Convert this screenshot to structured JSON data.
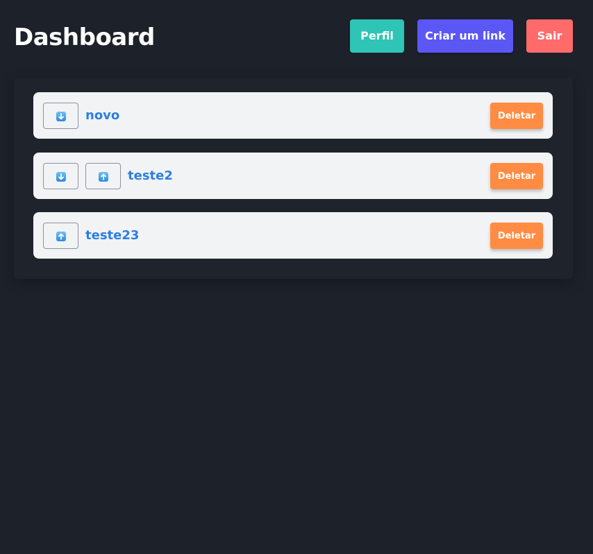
{
  "header": {
    "title": "Dashboard",
    "perfil_label": "Perfil",
    "criar_label": "Criar um link",
    "sair_label": "Sair"
  },
  "links": [
    {
      "name": "novo",
      "buttons": [
        "down-arrow-icon"
      ],
      "delete_label": "Deletar"
    },
    {
      "name": "teste2",
      "buttons": [
        "down-arrow-icon",
        "up-arrow-icon"
      ],
      "delete_label": "Deletar"
    },
    {
      "name": "teste23",
      "buttons": [
        "up-arrow-icon"
      ],
      "delete_label": "Deletar"
    }
  ],
  "colors": {
    "background": "#1d2129",
    "perfil": "#2ec4b6",
    "criar": "#5b57f5",
    "sair": "#ff6b6b",
    "deletar": "#ff8c42",
    "link_text": "#2b7fe0",
    "row_background": "#f2f3f5"
  }
}
